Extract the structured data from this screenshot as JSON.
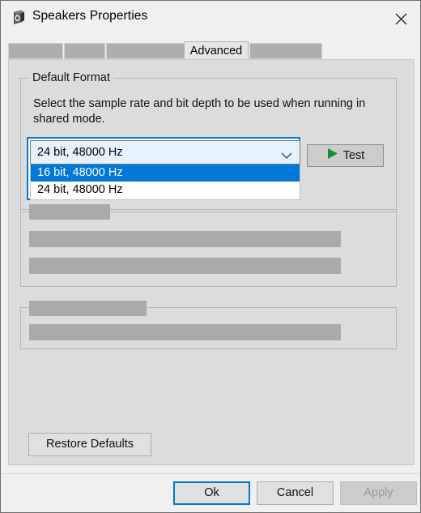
{
  "window": {
    "title": "Speakers Properties",
    "icon": "speaker-icon",
    "close_label": "✕"
  },
  "tabs": {
    "items": [
      {
        "label": "",
        "redacted": true,
        "active": false
      },
      {
        "label": "",
        "redacted": true,
        "active": false
      },
      {
        "label": "",
        "redacted": true,
        "active": false
      },
      {
        "label": "Advanced",
        "redacted": false,
        "active": true
      },
      {
        "label": "",
        "redacted": true,
        "active": false
      }
    ],
    "active_label": "Advanced"
  },
  "default_format": {
    "legend": "Default Format",
    "description": "Select the sample rate and bit depth to be used when running in shared mode.",
    "combo": {
      "value": "24 bit, 48000 Hz",
      "expanded": true,
      "options": [
        {
          "label": "16 bit, 48000 Hz",
          "selected": true
        },
        {
          "label": "24 bit, 48000 Hz",
          "selected": false
        }
      ]
    },
    "test_button": {
      "label": "Test",
      "icon": "play-icon",
      "icon_color": "#1e8a37"
    }
  },
  "group_two": {
    "legend": "",
    "redacted": true,
    "rows": [
      {
        "redacted": true
      },
      {
        "redacted": true
      }
    ]
  },
  "group_three": {
    "legend": "",
    "redacted": true,
    "rows": [
      {
        "redacted": true
      }
    ]
  },
  "restore_defaults": {
    "label": "Restore Defaults"
  },
  "footer": {
    "buttons": [
      {
        "label": "Ok",
        "state": "default"
      },
      {
        "label": "Cancel",
        "state": "normal"
      },
      {
        "label": "Apply",
        "state": "disabled"
      }
    ]
  },
  "colors": {
    "accent": "#0078d7",
    "dialog_bg": "#f0f0f0",
    "panel_bg": "#dcdcdc",
    "redaction": "#aaaaaa",
    "combo_field_bg": "#e5f1fb",
    "play_green": "#1e8a37"
  }
}
